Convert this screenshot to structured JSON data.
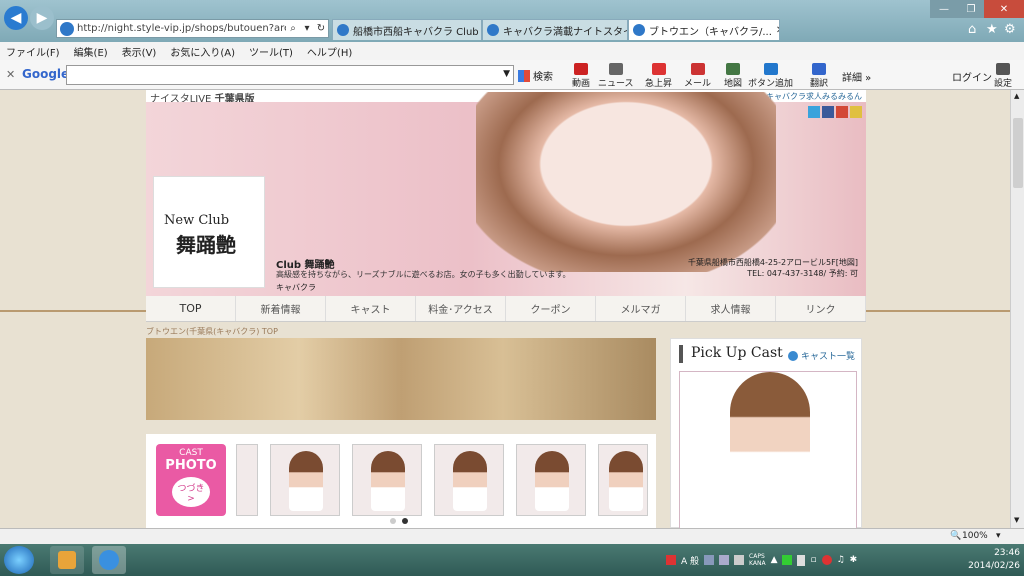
{
  "browser": {
    "address_url": "http://night.style-vip.jp/shops/butouen?area=chi",
    "tabs": [
      {
        "label": "船橋市西船キャバクラ Club ..."
      },
      {
        "label": "キャバクラ満載ナイトスタイ..."
      },
      {
        "label": "ブトウエン（キャバクラ/..."
      }
    ],
    "menu": [
      "ファイル(F)",
      "編集(E)",
      "表示(V)",
      "お気に入り(A)",
      "ツール(T)",
      "ヘルプ(H)"
    ],
    "google_bar": {
      "logo": "Google",
      "search_label": "検索",
      "tools": [
        {
          "label": "動画",
          "color": "#cc2222"
        },
        {
          "label": "ニュース",
          "color": "#666666"
        },
        {
          "label": "急上昇",
          "color": "#dd3333"
        },
        {
          "label": "メール",
          "color": "#cc3333"
        },
        {
          "label": "地図",
          "color": "#447744"
        },
        {
          "label": "ボタン追加",
          "color": "#2277cc"
        },
        {
          "label": "翻訳",
          "color": "#3366cc"
        }
      ],
      "more_label": "詳細 »",
      "login_label": "ログイン",
      "settings_label": "設定"
    },
    "zoom": "100%"
  },
  "site": {
    "brand": "ナイスタLIVE",
    "region": "千葉県版",
    "powered_text": "powered by キャバクラ満載ナイスタLIVE   supported by キャバクラ求人みるみるん",
    "shop": {
      "logo_line1": "New Club",
      "logo_line2": "舞踊艶",
      "name": "Club 舞踊艶",
      "description": "高級感を持ちながら、リーズナブルに遊べるお店。女の子も多く出勤しています。",
      "category": "キャバクラ",
      "address": "千葉県船橋市西船橋4-25-2アロービル5F[地図]",
      "tel": "TEL: 047-437-3148/ 予約: 可"
    },
    "nav": [
      "TOP",
      "新着情報",
      "キャスト",
      "料金･アクセス",
      "クーポン",
      "メルマガ",
      "求人情報",
      "リンク"
    ],
    "breadcrumb": "ブトウエン(千葉県(キャバクラ) TOP",
    "cast_photo": {
      "line1": "CAST",
      "line2": "PHOTO",
      "more": "つづき",
      "arrow": ">"
    },
    "pickup": {
      "title": "Pick Up Cast",
      "link": "キャスト一覧"
    }
  },
  "taskbar": {
    "tray_text": "A 般",
    "caps": "CAPS",
    "kana": "KANA",
    "time": "23:46",
    "date": "2014/02/26"
  }
}
